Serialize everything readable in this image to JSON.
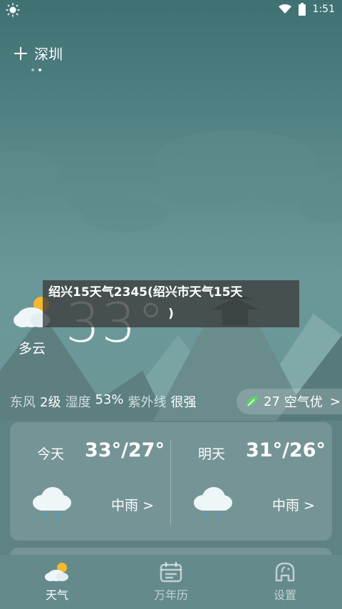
{
  "status_bar": {
    "time": "1:51"
  },
  "header": {
    "city": "深圳",
    "page_dots": 2,
    "active_dot": 1
  },
  "banner": {
    "line1": "绍兴15天气2345(绍兴市天气15天",
    "line2": ")"
  },
  "current": {
    "temperature": "33°",
    "condition": "多云"
  },
  "meta": {
    "wind_label": "东风",
    "wind_value": "2级",
    "humidity_label": "湿度",
    "humidity_value": "53%",
    "uv_label": "紫外线",
    "uv_value": "很强"
  },
  "aqi": {
    "value": "27",
    "label": "空气优",
    "chevron": ">"
  },
  "forecast": [
    {
      "day": "今天",
      "temp": "33°/27°",
      "condition": "中雨 >",
      "icon": "rain-cloud-icon"
    },
    {
      "day": "明天",
      "temp": "31°/26°",
      "condition": "中雨 >",
      "icon": "rain-cloud-icon"
    }
  ],
  "tabs": [
    {
      "label": "天气",
      "icon": "weather-tab-icon",
      "active": true
    },
    {
      "label": "万年历",
      "icon": "calendar-icon",
      "active": false
    },
    {
      "label": "设置",
      "icon": "settings-elephant-icon",
      "active": false
    }
  ],
  "colors": {
    "background_top": "#4d7d7f",
    "background_bottom": "#5e8587",
    "tabbar": "#648a8c",
    "sun": "#f5b82e",
    "leaf": "#5fd06b"
  }
}
